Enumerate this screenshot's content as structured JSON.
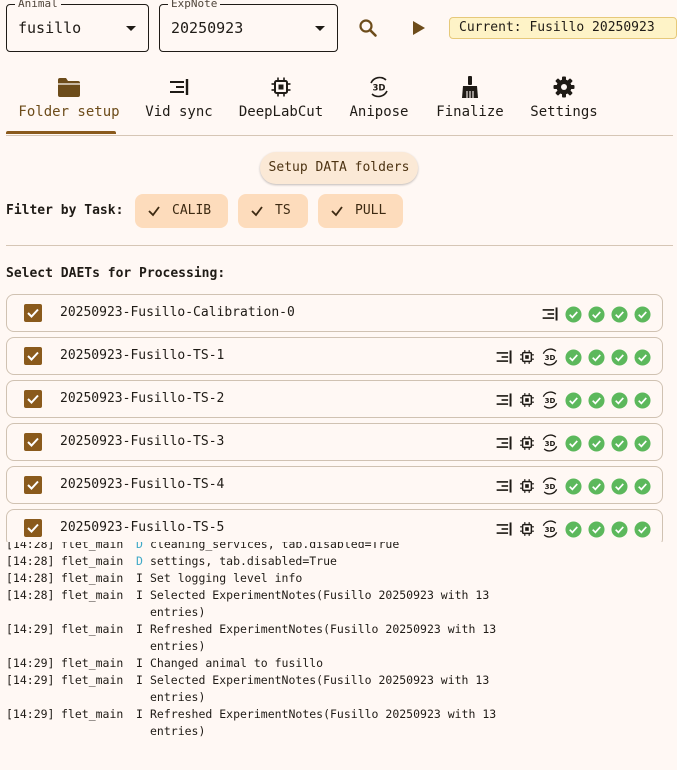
{
  "header": {
    "animal": {
      "label": "Animal",
      "value": "fusillo"
    },
    "expnote": {
      "label": "ExpNote",
      "value": "20250923"
    },
    "search_icon": "search-icon",
    "run_icon": "play-icon",
    "current": "Current: Fusillo 20250923"
  },
  "tabs": [
    {
      "label": "Folder setup",
      "icon": "folder-icon",
      "active": true
    },
    {
      "label": "Vid sync",
      "icon": "sync-icon"
    },
    {
      "label": "DeepLabCut",
      "icon": "chip-icon"
    },
    {
      "label": "Anipose",
      "icon": "3d-rotation-icon"
    },
    {
      "label": "Finalize",
      "icon": "broom-icon"
    },
    {
      "label": "Settings",
      "icon": "gear-icon"
    }
  ],
  "setup_button": "Setup DATA folders",
  "filter": {
    "label": "Filter by Task:",
    "chips": [
      {
        "label": "CALIB",
        "selected": true
      },
      {
        "label": "TS",
        "selected": true
      },
      {
        "label": "PULL",
        "selected": true
      }
    ]
  },
  "select_label": "Select DAETs for Processing:",
  "daets": [
    {
      "name": "20250923-Fusillo-Calibration-0",
      "checked": true,
      "steps": [
        "sync",
        "check",
        "check",
        "check",
        "check"
      ]
    },
    {
      "name": "20250923-Fusillo-TS-1",
      "checked": true,
      "steps": [
        "sync",
        "chip",
        "3d",
        "check",
        "check",
        "check",
        "check"
      ]
    },
    {
      "name": "20250923-Fusillo-TS-2",
      "checked": true,
      "steps": [
        "sync",
        "chip",
        "3d",
        "check",
        "check",
        "check",
        "check"
      ]
    },
    {
      "name": "20250923-Fusillo-TS-3",
      "checked": true,
      "steps": [
        "sync",
        "chip",
        "3d",
        "check",
        "check",
        "check",
        "check"
      ]
    },
    {
      "name": "20250923-Fusillo-TS-4",
      "checked": true,
      "steps": [
        "sync",
        "chip",
        "3d",
        "check",
        "check",
        "check",
        "check"
      ]
    },
    {
      "name": "20250923-Fusillo-TS-5",
      "checked": true,
      "steps": [
        "sync",
        "chip",
        "3d",
        "check",
        "check",
        "check",
        "check"
      ]
    }
  ],
  "log": [
    {
      "time": "[14:28]",
      "src": "flet_main",
      "lvl": "D",
      "msg": "cleaning_services, tab.disabled=True"
    },
    {
      "time": "[14:28]",
      "src": "flet_main",
      "lvl": "D",
      "msg": "settings, tab.disabled=True"
    },
    {
      "time": "[14:28]",
      "src": "flet_main",
      "lvl": "I",
      "msg": "Set logging level info"
    },
    {
      "time": "[14:28]",
      "src": "flet_main",
      "lvl": "I",
      "msg": "Selected ExperimentNotes(Fusillo 20250923 with 13"
    },
    {
      "time": "",
      "src": "",
      "lvl": "",
      "msg": "entries)"
    },
    {
      "time": "[14:29]",
      "src": "flet_main",
      "lvl": "I",
      "msg": "Refreshed ExperimentNotes(Fusillo 20250923 with 13"
    },
    {
      "time": "",
      "src": "",
      "lvl": "",
      "msg": "entries)"
    },
    {
      "time": "[14:29]",
      "src": "flet_main",
      "lvl": "I",
      "msg": "Changed animal to fusillo"
    },
    {
      "time": "[14:29]",
      "src": "flet_main",
      "lvl": "I",
      "msg": "Selected ExperimentNotes(Fusillo 20250923 with 13"
    },
    {
      "time": "",
      "src": "",
      "lvl": "",
      "msg": "entries)"
    },
    {
      "time": "[14:29]",
      "src": "flet_main",
      "lvl": "I",
      "msg": "Refreshed ExperimentNotes(Fusillo 20250923 with 13"
    },
    {
      "time": "",
      "src": "",
      "lvl": "",
      "msg": "entries)"
    }
  ],
  "colors": {
    "accent": "#8a5a1c",
    "success": "#5cb85c",
    "chip_bg": "#fddcbc",
    "current_bg": "#fef3c7",
    "debug": "#3fa9c7"
  }
}
